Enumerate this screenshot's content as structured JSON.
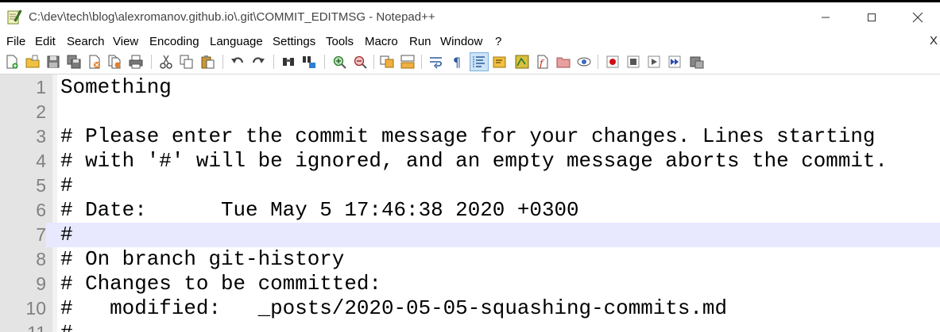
{
  "window": {
    "title": "C:\\dev\\tech\\blog\\alexromanov.github.io\\.git\\COMMIT_EDITMSG - Notepad++"
  },
  "menu": {
    "items": [
      "File",
      "Edit",
      "Search",
      "View",
      "Encoding",
      "Language",
      "Settings",
      "Tools",
      "Macro",
      "Run",
      "Window",
      "?"
    ],
    "close_label": "X"
  },
  "editor": {
    "current_line": 7,
    "lines": [
      {
        "number": "1",
        "text": "Something"
      },
      {
        "number": "2",
        "text": ""
      },
      {
        "number": "3",
        "text": "# Please enter the commit message for your changes. Lines starting"
      },
      {
        "number": "4",
        "text": "# with '#' will be ignored, and an empty message aborts the commit."
      },
      {
        "number": "5",
        "text": "#"
      },
      {
        "number": "6",
        "text": "# Date:      Tue May 5 17:46:38 2020 +0300"
      },
      {
        "number": "7",
        "text": "#"
      },
      {
        "number": "8",
        "text": "# On branch git-history"
      },
      {
        "number": "9",
        "text": "# Changes to be committed:"
      },
      {
        "number": "10",
        "text": "#   modified:   _posts/2020-05-05-squashing-commits.md"
      },
      {
        "number": "11",
        "text": "#"
      }
    ]
  },
  "toolbar": {
    "icons": [
      "new-file-icon",
      "open-file-icon",
      "save-icon",
      "save-all-icon",
      "close-icon",
      "close-all-icon",
      "print-icon",
      "cut-icon",
      "copy-icon",
      "paste-icon",
      "undo-icon",
      "redo-icon",
      "find-icon",
      "replace-icon",
      "zoom-in-icon",
      "zoom-out-icon",
      "sync-vertical-icon",
      "sync-horizontal-icon",
      "word-wrap-icon",
      "show-all-chars-icon",
      "indent-guide-icon",
      "user-language-icon",
      "doc-map-icon",
      "function-list-icon",
      "folder-workspace-icon",
      "monitoring-icon",
      "record-macro-icon",
      "stop-macro-icon",
      "play-macro-icon",
      "run-macro-multiple-icon",
      "save-macro-icon"
    ]
  },
  "colors": {
    "current_line_bg": "#e8e8ff",
    "gutter_bg": "#e4e4e4",
    "line_number": "#808080"
  }
}
